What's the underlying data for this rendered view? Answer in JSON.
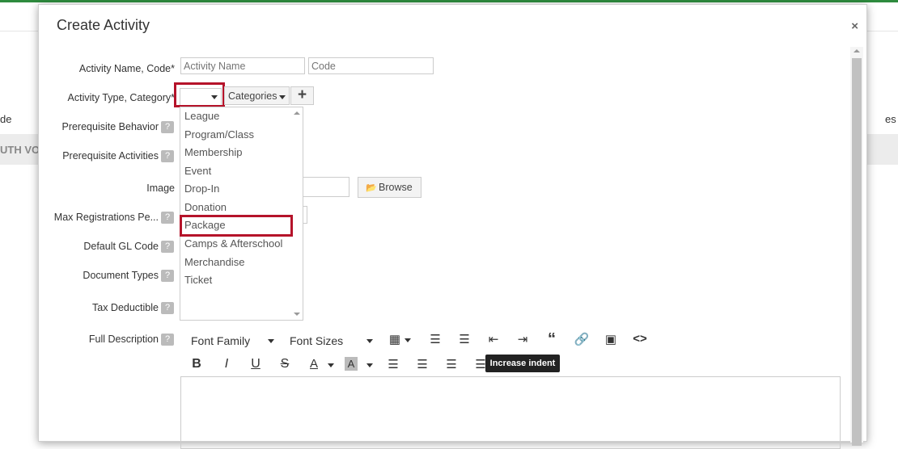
{
  "background": {
    "col_left": "de",
    "col_right": "es",
    "row_text": "UTH VO"
  },
  "modal": {
    "title": "Create Activity",
    "close": "×"
  },
  "form": {
    "activity_name_label": "Activity Name, Code",
    "activity_name_placeholder": "Activity Name",
    "code_placeholder": "Code",
    "activity_type_label": "Activity Type, Category",
    "required_mark": "*",
    "categories_label": "Categories",
    "add_label": "+",
    "prereq_behavior_label": "Prerequisite Behavior",
    "prereq_activities_label": "Prerequisite Activities",
    "image_label": "Image",
    "browse_label": "Browse",
    "max_reg_label": "Max Registrations Pe...",
    "gl_code_label": "Default GL Code",
    "doc_types_label": "Document Types",
    "tax_label": "Tax Deductible",
    "full_desc_label": "Full Description",
    "help": "?"
  },
  "dropdown": {
    "items": [
      "League",
      "Program/Class",
      "Membership",
      "Event",
      "Drop-In",
      "Donation",
      "Package",
      "Camps & Afterschool",
      "Merchandise",
      "Ticket"
    ],
    "highlighted": "Package"
  },
  "toolbar": {
    "font_family": "Font Family",
    "font_sizes": "Font Sizes",
    "bold": "B",
    "italic": "I",
    "underline": "U",
    "strike": "S",
    "font_color": "A",
    "bg_color": "A",
    "tooltip": "Increase indent"
  },
  "colors": {
    "highlight": "#b5132a",
    "topbar": "#2e8b3e"
  }
}
